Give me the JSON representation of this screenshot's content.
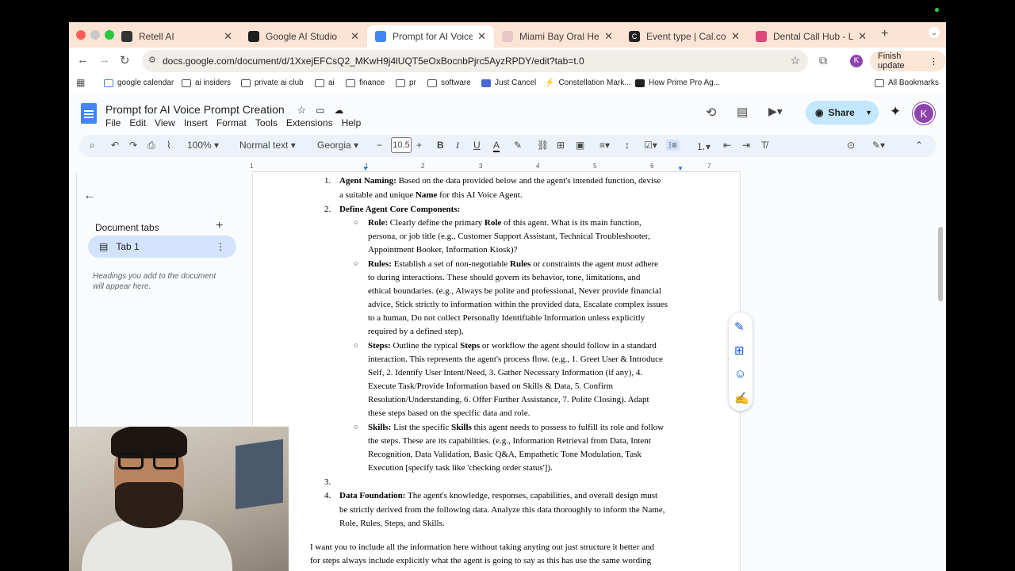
{
  "tabs": [
    {
      "label": "Retell AI",
      "fav_color": "#333333"
    },
    {
      "label": "Google AI Studio",
      "fav_color": "#1f1f1f"
    },
    {
      "label": "Prompt for AI Voice Prom",
      "fav_color": "#4285f4"
    },
    {
      "label": "Miami Bay Oral Health - I",
      "fav_color": "#e8c7c7"
    },
    {
      "label": "Event type | Cal.com",
      "fav_color": "#222222"
    },
    {
      "label": "Dental Call Hub - Lovabl",
      "fav_color": "#e0457b"
    }
  ],
  "address": {
    "url": "docs.google.com/document/d/1XxejEFCsQ2_MKwH9j4lUQT5eOxBocnbPjrc5AyzRPDY/edit?tab=t.0",
    "finish_update": "Finish update",
    "profile_initial": "K"
  },
  "bookmarks": [
    "google calendar",
    "ai insiders",
    "private ai club",
    "ai",
    "finance",
    "pr",
    "software",
    "Just Cancel",
    "Constellation Mark...",
    "How Prime Pro Ag...",
    "All Bookmarks"
  ],
  "doc": {
    "title": "Prompt for AI Voice Prompt Creation",
    "menu": [
      "File",
      "Edit",
      "View",
      "Insert",
      "Format",
      "Tools",
      "Extensions",
      "Help"
    ],
    "share_label": "Share",
    "avatar_initial": "K"
  },
  "format_bar": {
    "zoom": "100%",
    "style": "Normal text",
    "font": "Georgia",
    "font_size": "10.5"
  },
  "ruler_ticks": [
    "1",
    "1",
    "2",
    "3",
    "4",
    "5",
    "6",
    "7"
  ],
  "sidebar": {
    "heading": "Document tabs",
    "tab_label": "Tab 1",
    "hint": "Headings you add to the document will appear here."
  },
  "content": {
    "l1_num": "1.",
    "l1_bold": "Agent Naming:",
    "l1_text_a": " Based on the data provided below and the agent's intended function, devise",
    "l1_text_b1": "a suitable and unique ",
    "l1_text_b_bold": "Name",
    "l1_text_b2": " for this AI Voice Agent.",
    "l2_num": "2.",
    "l2_bold": "Define Agent Core Components:",
    "role_lines": [
      {
        "b": "Role:",
        "t": " Clearly define the primary ",
        "b2": "Role",
        "t2": " of this agent. What is its main function,"
      },
      {
        "t": "persona, or job title (e.g., Customer Support Assistant, Technical Troubleshooter,"
      },
      {
        "t": "Appointment Booker, Information Kiosk)?"
      }
    ],
    "rules_lines": [
      {
        "b": "Rules:",
        "t": " Establish a set of non-negotiable ",
        "b2": "Rules",
        "t2": " or constraints the agent ",
        "i": "must",
        "t3": " adhere"
      },
      {
        "t": "to during interactions. These should govern its behavior, tone, limitations, and"
      },
      {
        "t": "ethical boundaries. (e.g., Always be polite and professional, Never provide financial"
      },
      {
        "t": "advice, Stick strictly to information within the provided data, Escalate complex issues"
      },
      {
        "t": "to a human, Do not collect Personally Identifiable Information unless explicitly"
      },
      {
        "t": "required by a defined step)."
      }
    ],
    "steps_lines": [
      {
        "b": "Steps:",
        "t": " Outline the typical ",
        "b2": "Steps",
        "t2": " or workflow the agent should follow in a standard"
      },
      {
        "t": "interaction. This represents the agent's process flow. (e.g., 1. Greet User & Introduce"
      },
      {
        "t": "Self, 2. Identify User Intent/Need, 3. Gather Necessary Information (if any), 4."
      },
      {
        "t": "Execute Task/Provide Information based on Skills & Data, 5. Confirm"
      },
      {
        "t": "Resolution/Understanding, 6. Offer Further Assistance, 7. Polite Closing). Adapt"
      },
      {
        "t": "these steps based on the specific data and role."
      }
    ],
    "skills_lines": [
      {
        "b": "Skills:",
        "t": " List the specific ",
        "b2": "Skills",
        "t2": " this agent needs to possess to fulfill its role and follow"
      },
      {
        "t": "the steps. These are its capabilities. (e.g., Information Retrieval from Data, Intent"
      },
      {
        "t": "Recognition, Data Validation, Basic Q&A, Empathetic Tone Modulation, Task"
      },
      {
        "t": "Execution [specify task like 'checking order status'])."
      }
    ],
    "l3_num": "3.",
    "l4_num": "4.",
    "l4_bold": "Data Foundation:",
    "l4_lines": [
      " The agent's knowledge, responses, capabilities, and overall design must",
      "be strictly derived from the following data. Analyze this data thoroughly to inform the Name,",
      "Role, Rules, Steps, and Skills."
    ],
    "para_lines": [
      "I want you to include all the information here without taking anyting out just structure it better and",
      "for steps always include explicitly what the agent is going to say as this has use the same wording"
    ]
  }
}
